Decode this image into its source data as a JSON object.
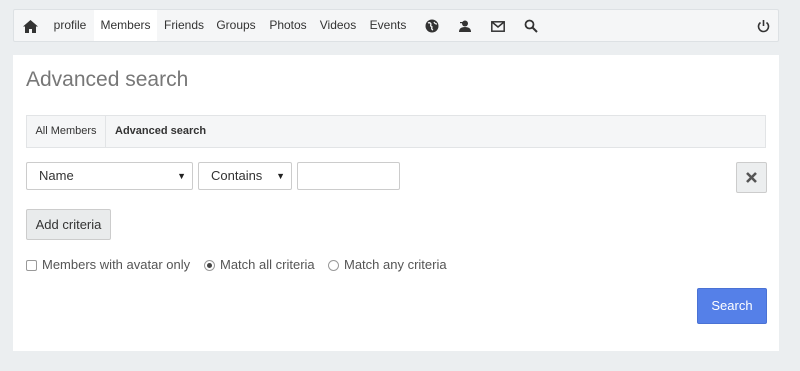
{
  "nav": {
    "items": [
      {
        "label": "profile"
      },
      {
        "label": "Members",
        "active": true
      },
      {
        "label": "Friends"
      },
      {
        "label": "Groups"
      },
      {
        "label": "Photos"
      },
      {
        "label": "Videos"
      },
      {
        "label": "Events"
      }
    ],
    "icons": [
      "home-icon",
      "globe-icon",
      "friend-request-icon",
      "mail-icon",
      "search-icon",
      "power-icon"
    ]
  },
  "page": {
    "title": "Advanced search",
    "subnav": {
      "all_members": "All Members",
      "advanced_search": "Advanced search"
    }
  },
  "criteria": {
    "field": "Name",
    "operator": "Contains",
    "value": "",
    "clear_icon": "close-icon",
    "add_label": "Add criteria"
  },
  "options": {
    "avatar_only": {
      "label": "Members with avatar only",
      "checked": false
    },
    "match_all": {
      "label": "Match all criteria",
      "selected": true
    },
    "match_any": {
      "label": "Match any criteria",
      "selected": false
    }
  },
  "search_button": "Search",
  "colors": {
    "accent": "#5580e8",
    "background": "#ebeef0"
  }
}
